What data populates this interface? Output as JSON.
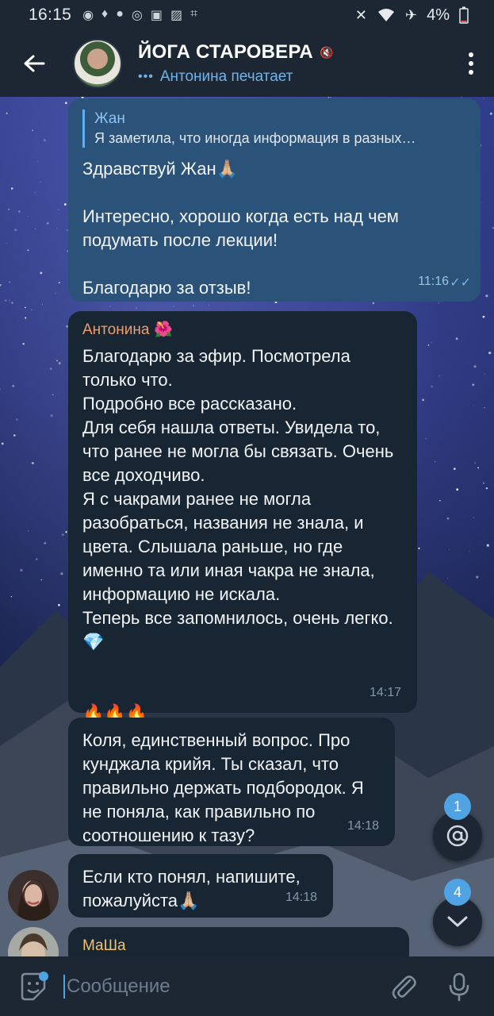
{
  "status_bar": {
    "time": "16:15",
    "battery": "4%"
  },
  "header": {
    "title": "ЙОГА СТАРОВЕРА",
    "typing": "Антонина печатает"
  },
  "messages": [
    {
      "reply_name": "Жан",
      "reply_text": "Я заметила, что иногда информация в разных…",
      "text": "Здравствуй Жан🙏🏼\n\nИнтересно, хорошо когда есть над чем подумать после лекции!\n\nБлагодарю за отзыв!",
      "time": "11:16"
    },
    {
      "sender": "Антонина",
      "sender_emoji": "🌺",
      "text": "Благодарю за эфир. Посмотрела только что.\nПодробно все рассказано.\nДля себя нашла ответы. Увидела то, что ранее не могла бы связать. Очень все доходчиво.\nЯ с чакрами ранее не могла разобраться, названия не знала, и цвета. Слышала раньше, но где именно та или иная чакра не знала, информацию не искала.\nТеперь все запомнилось, очень легко. 💎\n\n\n🔥🔥🔥",
      "time": "14:17"
    },
    {
      "text": "Коля, единственный вопрос. Про кунджала крийя. Ты сказал, что правильно держать подбородок. Я не поняла, как правильно по соотношению к тазу?",
      "time": "14:18"
    },
    {
      "text": "Если кто понял, напишите, пожалуйста🙏🏼",
      "time": "14:18"
    },
    {
      "sender": "МаШа"
    }
  ],
  "badges": {
    "mentions": "1",
    "unread": "4"
  },
  "input": {
    "placeholder": "Сообщение"
  },
  "colors": {
    "header_bg": "#1c2733",
    "bubble_in": "#182533",
    "bubble_out": "#2b5278",
    "accent": "#4fa3e3"
  }
}
